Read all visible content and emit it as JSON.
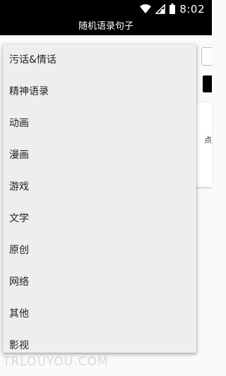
{
  "status_bar": {
    "time": "8:02",
    "icons": [
      "wifi-icon",
      "signal-icon",
      "battery-icon"
    ]
  },
  "app_bar": {
    "title": "随机语录句子"
  },
  "background": {
    "card_text": "点",
    "watermark": "TRLOUYOU.COM"
  },
  "dropdown": {
    "items": [
      "污话&情话",
      "精神语录",
      "动画",
      "漫画",
      "游戏",
      "文学",
      "原创",
      "网络",
      "其他",
      "影视"
    ]
  },
  "colors": {
    "bar_background": "#000000",
    "dropdown_background": "#eeeeee",
    "page_background": "#fafafa"
  }
}
